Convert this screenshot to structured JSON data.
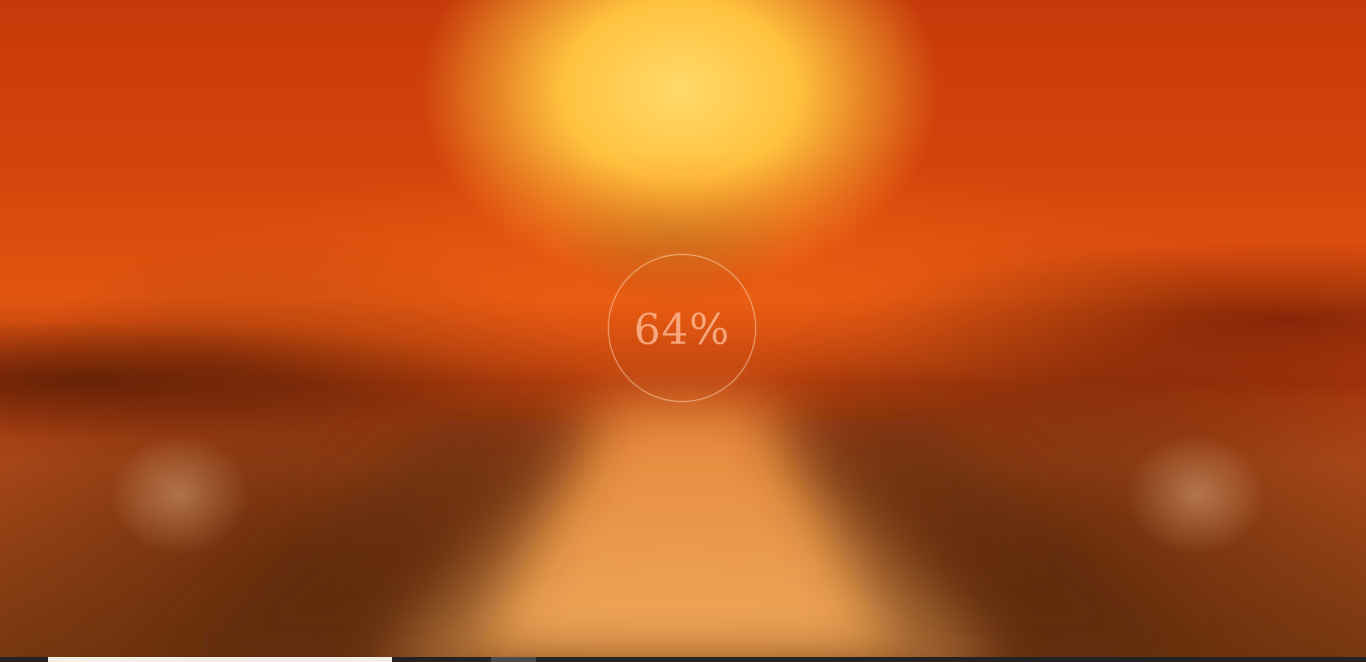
{
  "loader": {
    "progress_text": "64%",
    "progress_value": 0.64
  },
  "colors": {
    "background_primary": "#d4430b",
    "sun_glow": "#ffd96a",
    "circle_border": "#ffdcbe",
    "progress_text": "#ffc3a0",
    "bottom_bar": "#232323",
    "bottom_bar_loaded": "#f2efe9",
    "bottom_bar_thumb": "#4a4a4a"
  },
  "bottom_bar": {
    "segments": [
      {
        "name": "loaded-segment"
      },
      {
        "name": "thumb-segment"
      }
    ]
  }
}
